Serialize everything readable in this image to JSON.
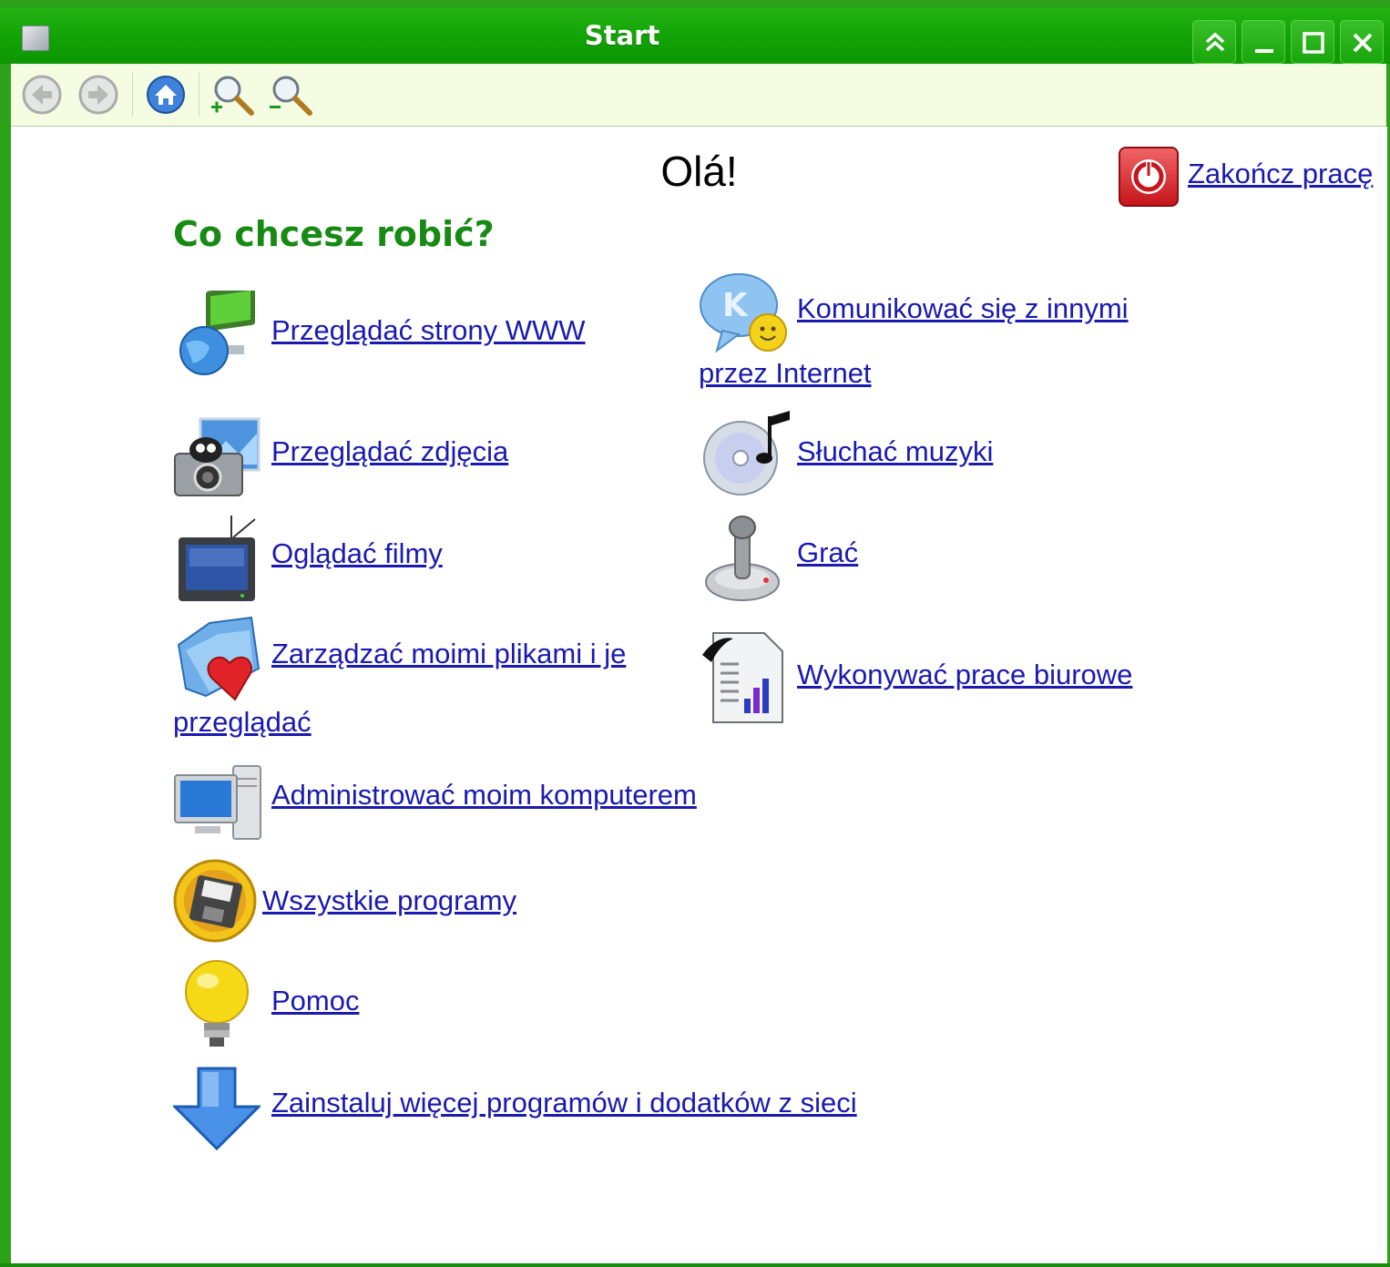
{
  "window": {
    "title": "Start",
    "controls": [
      "shade",
      "minimize",
      "maximize",
      "close"
    ]
  },
  "toolbar": {
    "buttons": [
      "back-icon",
      "forward-icon",
      "home-icon",
      "zoom-in-icon",
      "zoom-out-icon"
    ]
  },
  "main": {
    "greeting": "Olá!",
    "logout_label": "Zakończ pracę",
    "question": "Co chcesz robić?",
    "items": {
      "web": "Przeglądać strony WWW",
      "chat_line1": "Komunikować się z innymi",
      "chat_line2": "przez Internet",
      "photos": "Przeglądać zdjęcia",
      "music": "Słuchać muzyki",
      "movies": "Oglądać filmy",
      "games": "Grać",
      "files_line1": "Zarządzać moimi plikami i je",
      "files_line2": "przeglądać",
      "office": "Wykonywać prace biurowe",
      "admin": "Administrować moim komputerem",
      "all_programs": "Wszystkie programy",
      "help": "Pomoc",
      "install": "Zainstaluj więcej programów i dodatków z sieci"
    }
  },
  "colors": {
    "titlebar": "#12a205",
    "toolbar_bg": "#f4fce2",
    "heading": "#178a13",
    "link": "#1a1ab0"
  }
}
